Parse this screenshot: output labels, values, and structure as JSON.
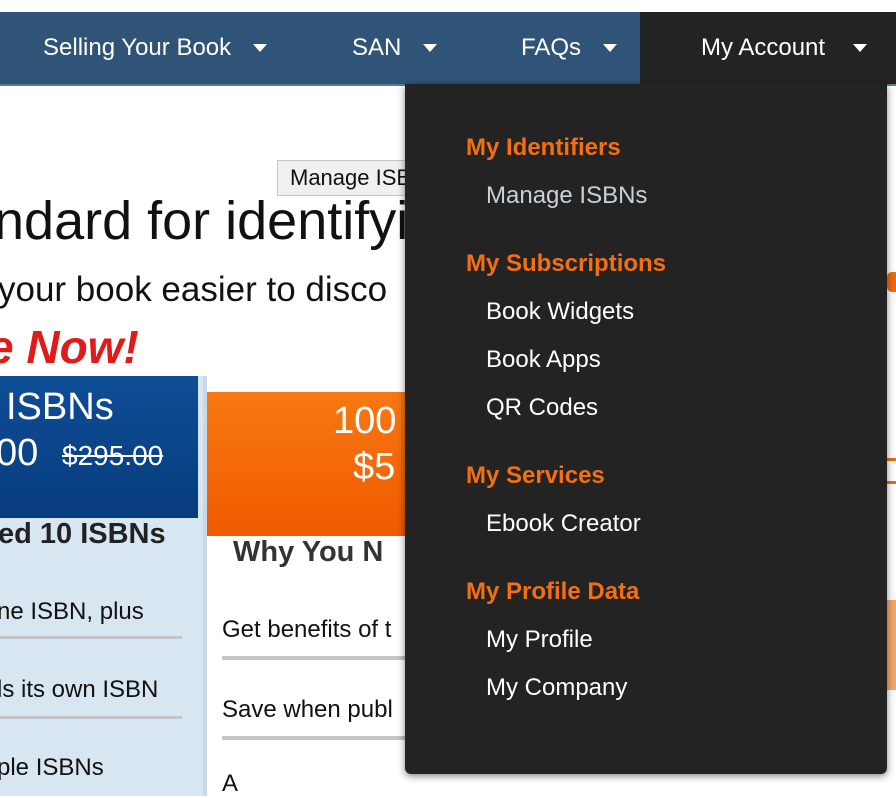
{
  "nav": {
    "items": [
      {
        "label": "Selling Your Book"
      },
      {
        "label": "SAN"
      },
      {
        "label": "FAQs"
      },
      {
        "label": "My Account"
      }
    ]
  },
  "background": {
    "headline": "ndard for identifyi",
    "subline": "your book easier to disco",
    "cta": "e Now!",
    "left_card": {
      "title": "ISBNs",
      "price": "00",
      "old_price": "$295.00",
      "subtitle": "ed 10 ISBNs",
      "rows": [
        "ne ISBN, plus",
        "ls its own ISBN",
        "ple ISBNs"
      ]
    },
    "mid_card": {
      "line1": "100",
      "line2": "$5",
      "title": "Why You N",
      "rows": [
        "Get benefits of t",
        "Save when publ",
        "A"
      ]
    }
  },
  "tooltip": {
    "text": "Manage ISBNs"
  },
  "dropdown": {
    "sections": [
      {
        "title": "My Identifiers",
        "items": [
          "Manage ISBNs"
        ]
      },
      {
        "title": "My Subscriptions",
        "items": [
          "Book Widgets",
          "Book Apps",
          "QR Codes"
        ]
      },
      {
        "title": "My Services",
        "items": [
          "Ebook Creator"
        ]
      },
      {
        "title": "My Profile Data",
        "items": [
          "My Profile",
          "My Company"
        ]
      }
    ]
  },
  "colors": {
    "nav_bg": "#2f5478",
    "dropdown_bg": "#232323",
    "section_orange": "#f36f14",
    "cta_red": "#e01b1b",
    "card_blue": "#0f4d95",
    "card_orange": "#f77812"
  }
}
